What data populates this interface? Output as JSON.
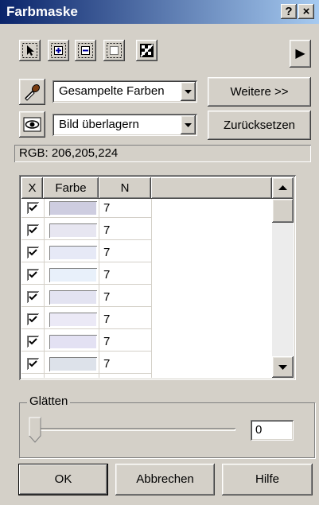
{
  "window": {
    "title": "Farbmaske",
    "help_glyph": "?",
    "close_glyph": "×"
  },
  "toolbar": {
    "tools": [
      "select-arrow-icon",
      "add-color-icon",
      "subtract-color-icon",
      "dotted-select-icon",
      "mask-toggle-icon"
    ],
    "menu_arrow": "▶"
  },
  "sample": {
    "combo_value": "Gesampelte Farben",
    "more_button": "Weitere >>"
  },
  "overlay": {
    "combo_value": "Bild überlagern",
    "reset_button": "Zurücksetzen"
  },
  "rgb_label": "RGB: 206,205,224",
  "table": {
    "columns": [
      "X",
      "Farbe",
      "N"
    ],
    "rows": [
      {
        "checked": true,
        "color": "#cecde0",
        "n": "7"
      },
      {
        "checked": true,
        "color": "#e7e6f1",
        "n": "7"
      },
      {
        "checked": true,
        "color": "#e6e9f6",
        "n": "7"
      },
      {
        "checked": true,
        "color": "#e8f0fa",
        "n": "7"
      },
      {
        "checked": true,
        "color": "#e3e3f1",
        "n": "7"
      },
      {
        "checked": true,
        "color": "#ebe9f6",
        "n": "7"
      },
      {
        "checked": true,
        "color": "#e3e1f3",
        "n": "7"
      },
      {
        "checked": true,
        "color": "#dde2ea",
        "n": "7"
      }
    ]
  },
  "smoothing": {
    "label": "Glätten",
    "value": "0",
    "slider_fraction": 0
  },
  "buttons": {
    "ok": "OK",
    "cancel": "Abbrechen",
    "help": "Hilfe"
  }
}
